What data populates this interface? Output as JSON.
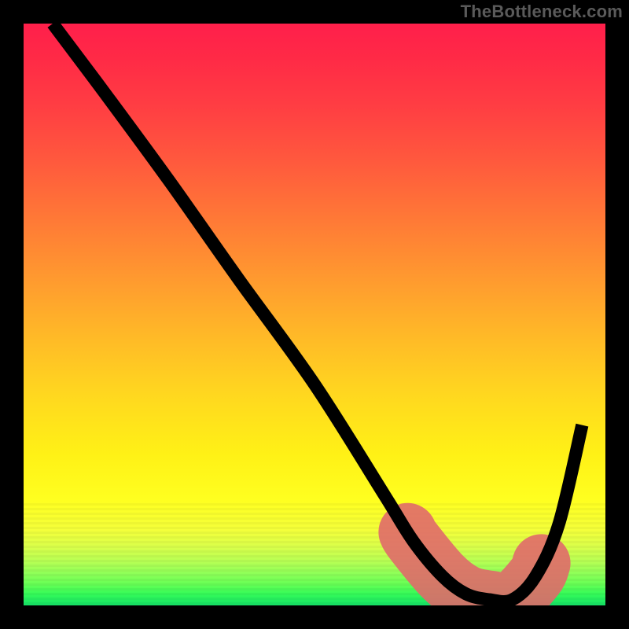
{
  "watermark": "TheBottleneck.com",
  "chart_data": {
    "type": "line",
    "title": "",
    "xlabel": "",
    "ylabel": "",
    "xlim": [
      0,
      100
    ],
    "ylim": [
      0,
      100
    ],
    "grid": false,
    "legend": false,
    "background": "rainbow-vertical-gradient",
    "series": [
      {
        "name": "bottleneck-curve",
        "x": [
          5,
          14,
          25,
          37,
          50,
          62,
          67,
          72,
          76,
          80,
          84,
          88,
          92,
          96
        ],
        "values": [
          100,
          88,
          73,
          56,
          38,
          19,
          11,
          5,
          2,
          1,
          1,
          5,
          14,
          31
        ],
        "note": "estimated; curve descends from top-left, bottoms out ~x=78-84, rises to ~31 at right edge"
      }
    ],
    "highlight_range": {
      "x_start": 66,
      "x_end": 89,
      "series": "bottleneck-curve"
    },
    "colors": {
      "curve": "#000000",
      "highlight": "#e06a6a",
      "gradient_top": "#ff1f4b",
      "gradient_mid": "#ffd81f",
      "gradient_bottom": "#14e566"
    }
  }
}
